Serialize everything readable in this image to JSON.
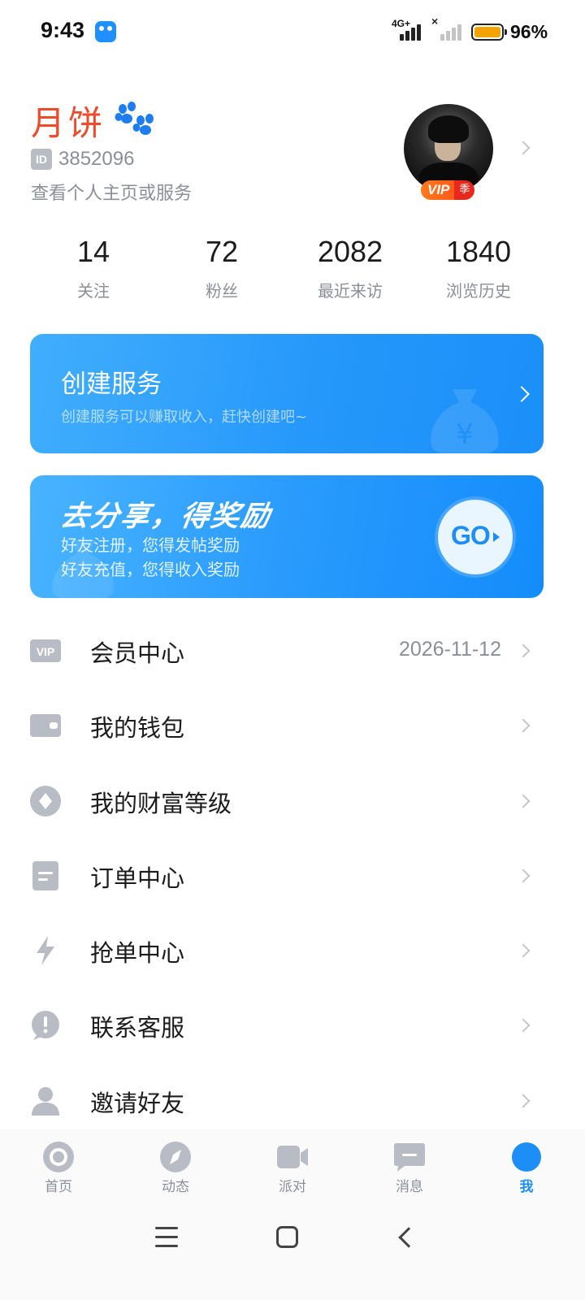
{
  "status_bar": {
    "time": "9:43",
    "network": "4G+",
    "battery": "96%",
    "battery_color": "#f5a300"
  },
  "profile": {
    "nickname": "月饼",
    "id_badge": "ID",
    "id_value": "3852096",
    "profile_link": "查看个人主页或服务",
    "vip_tag": "VIP",
    "vip_season": "季"
  },
  "stats": [
    {
      "value": "14",
      "label": "关注"
    },
    {
      "value": "72",
      "label": "粉丝"
    },
    {
      "value": "2082",
      "label": "最近来访"
    },
    {
      "value": "1840",
      "label": "浏览历史"
    }
  ],
  "service_card": {
    "title": "创建服务",
    "subtitle": "创建服务可以赚取收入，赶快创建吧~"
  },
  "share_card": {
    "title": "去分享，得奖励",
    "line1": "好友注册，您得发帖奖励",
    "line2": "好友充值，您得收入奖励",
    "go_label": "GO"
  },
  "menu": [
    {
      "icon": "vip-icon",
      "label": "会员中心",
      "value": "2026-11-12"
    },
    {
      "icon": "wallet-icon",
      "label": "我的钱包"
    },
    {
      "icon": "diamond-icon",
      "label": "我的财富等级"
    },
    {
      "icon": "document-icon",
      "label": "订单中心"
    },
    {
      "icon": "lightning-icon",
      "label": "抢单中心"
    },
    {
      "icon": "exclamation-icon",
      "label": "联系客服"
    },
    {
      "icon": "person-icon",
      "label": "邀请好友"
    }
  ],
  "tabs": [
    {
      "icon": "home-icon",
      "label": "首页"
    },
    {
      "icon": "compass-icon",
      "label": "动态"
    },
    {
      "icon": "video-icon",
      "label": "派对"
    },
    {
      "icon": "message-icon",
      "label": "消息"
    },
    {
      "icon": "me-icon",
      "label": "我",
      "active": true
    }
  ],
  "colors": {
    "accent": "#1e8ef7",
    "nickname": "#ee4b2b",
    "icon_gray": "#b8bcc4"
  }
}
